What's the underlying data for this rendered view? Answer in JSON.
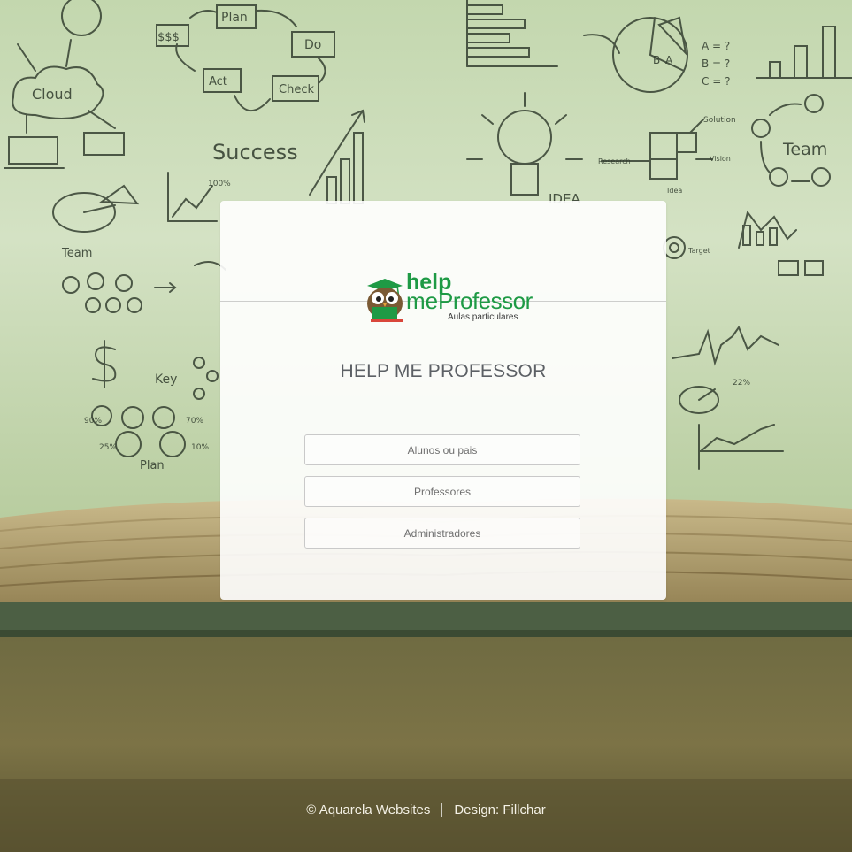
{
  "background": {
    "sketch_words": [
      "Plan",
      "Do",
      "Check",
      "Act",
      "$$$",
      "Cloud",
      "Success",
      "Team",
      "Key",
      "Plan",
      "IDEA",
      "Solution",
      "Research",
      "Vision",
      "Idea",
      "Team",
      "Target"
    ]
  },
  "card": {
    "logo": {
      "word_help": "help",
      "word_me": "me",
      "word_professor": "Professor",
      "tagline": "Aulas particulares"
    },
    "title": "HELP ME PROFESSOR",
    "buttons": [
      {
        "label": "Alunos ou pais"
      },
      {
        "label": "Professores"
      },
      {
        "label": "Administradores"
      }
    ]
  },
  "footer": {
    "copyright": "© Aquarela Websites",
    "design": "Design: Fillchar"
  },
  "colors": {
    "brand_green": "#1e9a45",
    "brand_dark": "#1d7a3c",
    "board_top": "#e8efd6",
    "board_mid": "#b8cda0",
    "table_wood": "#6f6a3a"
  }
}
